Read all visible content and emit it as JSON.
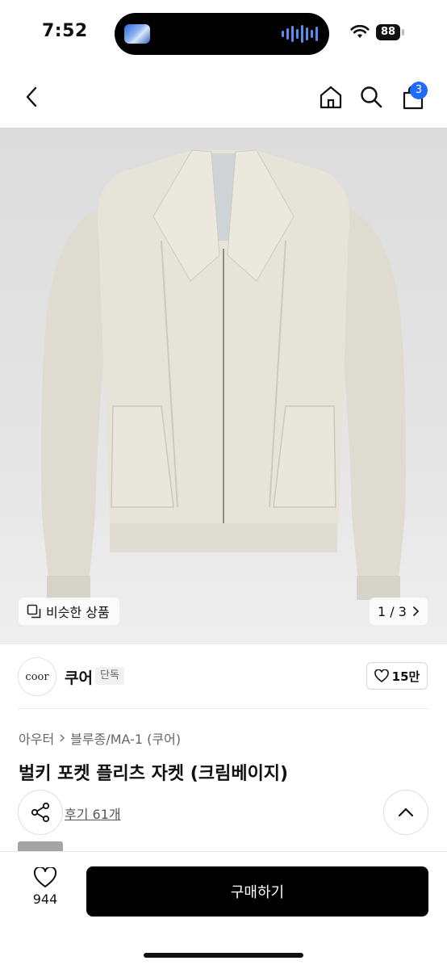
{
  "status_bar": {
    "time": "7:52",
    "battery": "88"
  },
  "nav": {
    "cart_count": "3"
  },
  "gallery": {
    "similar_label": "비슷한 상품",
    "page_indicator": "1 / 3"
  },
  "store": {
    "logo_text": "coor",
    "name": "쿠어",
    "tag": "단독",
    "likes": "15만"
  },
  "product": {
    "breadcrumb": [
      "아우터",
      "블루종/MA-1 (쿠어)"
    ],
    "title": "벌키 포켓 플리츠 자켓 (크림베이지)",
    "review_label": "후기 61개"
  },
  "bottom": {
    "wish_count": "944",
    "buy_label": "구매하기"
  },
  "colors": {
    "accent": "#1f6bff",
    "jacket": "#e6e3d8",
    "background": "#e2e2e2"
  }
}
